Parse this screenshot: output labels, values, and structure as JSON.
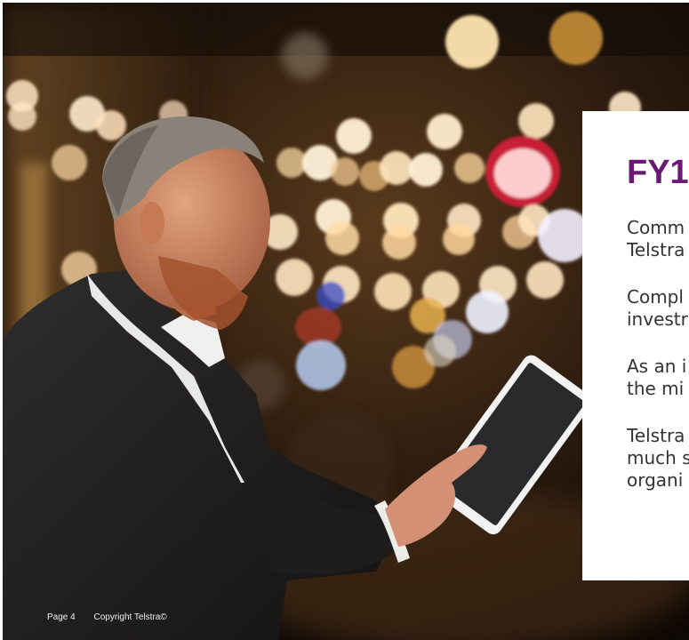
{
  "card": {
    "title": "FY1",
    "paragraphs": [
      "Comm\nTelstra",
      "Compl\ninvestr",
      "As an i\nthe mi",
      "Telstra\nmuch s\norgani"
    ]
  },
  "footer": {
    "page": "Page 4",
    "copyright": "Copyright Telstra©"
  }
}
